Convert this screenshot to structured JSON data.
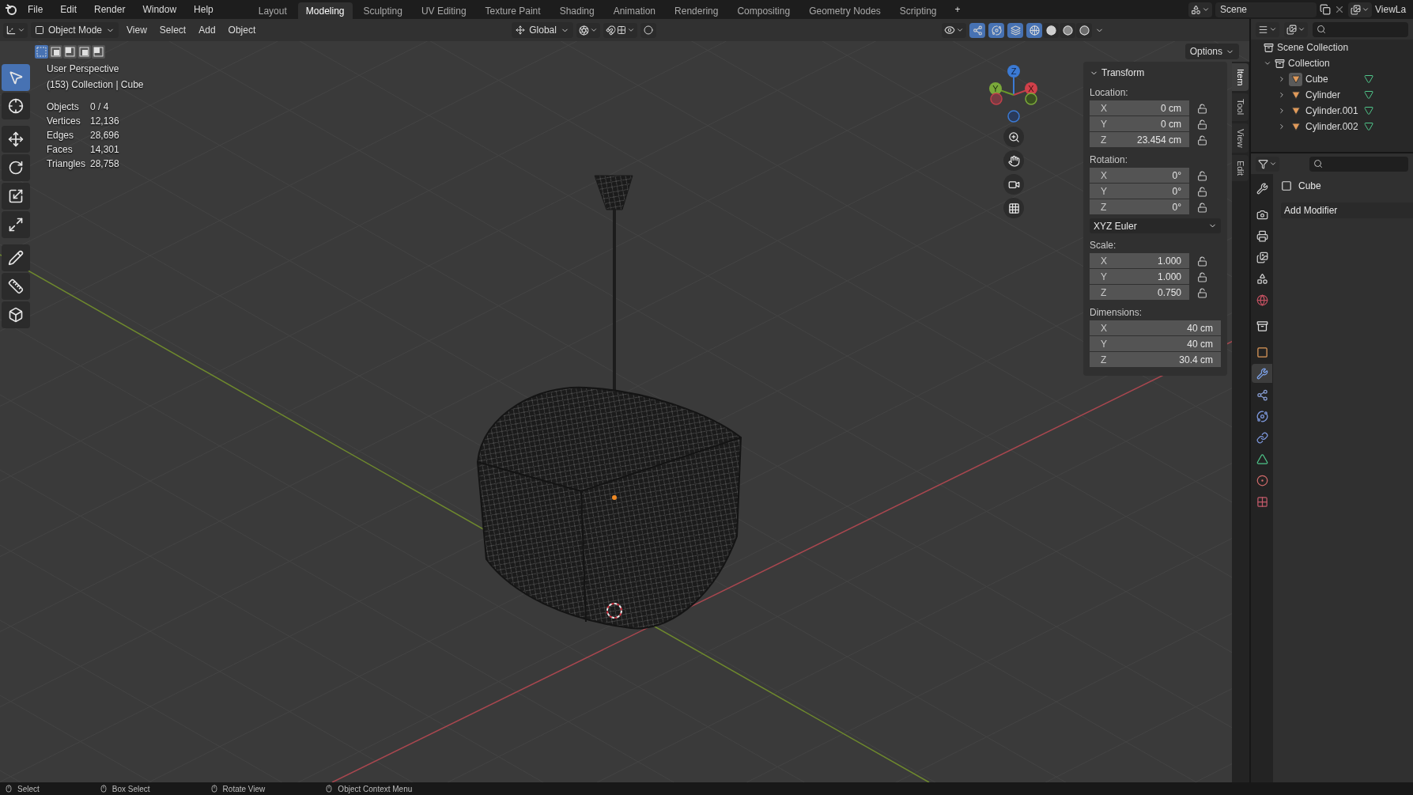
{
  "menu_bar": {
    "menus": [
      "File",
      "Edit",
      "Render",
      "Window",
      "Help"
    ]
  },
  "workspace_tabs": [
    {
      "label": "Layout",
      "selected": false
    },
    {
      "label": "Modeling",
      "selected": true
    },
    {
      "label": "Sculpting",
      "selected": false
    },
    {
      "label": "UV Editing",
      "selected": false
    },
    {
      "label": "Texture Paint",
      "selected": false
    },
    {
      "label": "Shading",
      "selected": false
    },
    {
      "label": "Animation",
      "selected": false
    },
    {
      "label": "Rendering",
      "selected": false
    },
    {
      "label": "Compositing",
      "selected": false
    },
    {
      "label": "Geometry Nodes",
      "selected": false
    },
    {
      "label": "Scripting",
      "selected": false
    }
  ],
  "add_workspace": "+",
  "scene": {
    "name": "Scene"
  },
  "view_layer": {
    "name": "ViewLa"
  },
  "viewport_header": {
    "mode": "Object Mode",
    "menus": [
      "View",
      "Select",
      "Add",
      "Object"
    ],
    "orientation": "Global",
    "shading": [
      {
        "kind": "wireframe",
        "selected": true
      },
      {
        "kind": "solid",
        "selected": false
      },
      {
        "kind": "material",
        "selected": false
      },
      {
        "kind": "rendered",
        "selected": false
      }
    ]
  },
  "selection_modes": [
    {
      "selected": true
    },
    {
      "selected": false
    },
    {
      "selected": false
    },
    {
      "selected": false
    },
    {
      "selected": false
    }
  ],
  "options_button": "Options",
  "overlay_info": {
    "view": "User Perspective",
    "context": "(153) Collection | Cube",
    "stats": [
      {
        "label": "Objects",
        "value": "0 / 4"
      },
      {
        "label": "Vertices",
        "value": "12,136"
      },
      {
        "label": "Edges",
        "value": "28,696"
      },
      {
        "label": "Faces",
        "value": "14,301"
      },
      {
        "label": "Triangles",
        "value": "28,758"
      }
    ]
  },
  "toolbar": [
    {
      "kind": "select",
      "selected": true
    },
    {
      "kind": "cursor",
      "selected": false
    },
    {
      "kind": "move",
      "selected": false
    },
    {
      "kind": "rotate",
      "selected": false
    },
    {
      "kind": "scale",
      "selected": false
    },
    {
      "kind": "transform",
      "selected": false
    },
    {
      "kind": "annotate",
      "selected": false
    },
    {
      "kind": "measure",
      "selected": false
    },
    {
      "kind": "add-cube",
      "selected": false
    }
  ],
  "gizmo_axes": [
    "Z",
    "Y",
    "X"
  ],
  "sidebar": {
    "tabs": [
      {
        "label": "Item",
        "selected": true
      },
      {
        "label": "Tool",
        "selected": false
      },
      {
        "label": "View",
        "selected": false
      },
      {
        "label": "Edit",
        "selected": false
      }
    ],
    "panel": {
      "title": "Transform",
      "expanded": true,
      "sections": [
        {
          "kind": "fields",
          "label": "Location:",
          "lockable": true,
          "fields": [
            {
              "axis": "X",
              "value": "0 cm"
            },
            {
              "axis": "Y",
              "value": "0 cm"
            },
            {
              "axis": "Z",
              "value": "23.454 cm"
            }
          ]
        },
        {
          "kind": "fields",
          "label": "Rotation:",
          "lockable": true,
          "fields": [
            {
              "axis": "X",
              "value": "0°"
            },
            {
              "axis": "Y",
              "value": "0°"
            },
            {
              "axis": "Z",
              "value": "0°"
            }
          ]
        },
        {
          "kind": "dropdown",
          "value": "XYZ Euler"
        },
        {
          "kind": "fields",
          "label": "Scale:",
          "lockable": true,
          "fields": [
            {
              "axis": "X",
              "value": "1.000"
            },
            {
              "axis": "Y",
              "value": "1.000"
            },
            {
              "axis": "Z",
              "value": "0.750"
            }
          ]
        },
        {
          "kind": "fields",
          "label": "Dimensions:",
          "lockable": false,
          "fields": [
            {
              "axis": "X",
              "value": "40 cm"
            },
            {
              "axis": "Y",
              "value": "40 cm"
            },
            {
              "axis": "Z",
              "value": "30.4 cm"
            }
          ]
        }
      ]
    }
  },
  "outliner": {
    "root": "Scene Collection",
    "items": [
      {
        "label": "Collection",
        "expanded": true,
        "children": [
          {
            "label": "Cube",
            "selected": true,
            "expanded": false
          },
          {
            "label": "Cylinder",
            "selected": false,
            "expanded": false
          },
          {
            "label": "Cylinder.001",
            "selected": false,
            "expanded": false
          },
          {
            "label": "Cylinder.002",
            "selected": false,
            "expanded": false
          }
        ]
      }
    ]
  },
  "properties": {
    "tabs": [
      {
        "kind": "tool",
        "selected": false
      },
      {
        "kind": "render",
        "selected": false
      },
      {
        "kind": "output",
        "selected": false
      },
      {
        "kind": "view-layer",
        "selected": false
      },
      {
        "kind": "scene",
        "selected": false
      },
      {
        "kind": "world",
        "selected": false
      },
      {
        "kind": "collection",
        "selected": false
      },
      {
        "kind": "object",
        "selected": false
      },
      {
        "kind": "modifiers",
        "selected": true
      },
      {
        "kind": "particles",
        "selected": false
      },
      {
        "kind": "physics",
        "selected": false
      },
      {
        "kind": "constraints",
        "selected": false
      },
      {
        "kind": "data",
        "selected": false
      },
      {
        "kind": "material",
        "selected": false
      },
      {
        "kind": "texture",
        "selected": false
      }
    ],
    "object": "Cube",
    "add_modifier": "Add Modifier"
  },
  "status_bar": [
    {
      "label": "Select"
    },
    {
      "label": "Box Select"
    },
    {
      "label": "Rotate View"
    },
    {
      "label": "Object Context Menu"
    }
  ]
}
